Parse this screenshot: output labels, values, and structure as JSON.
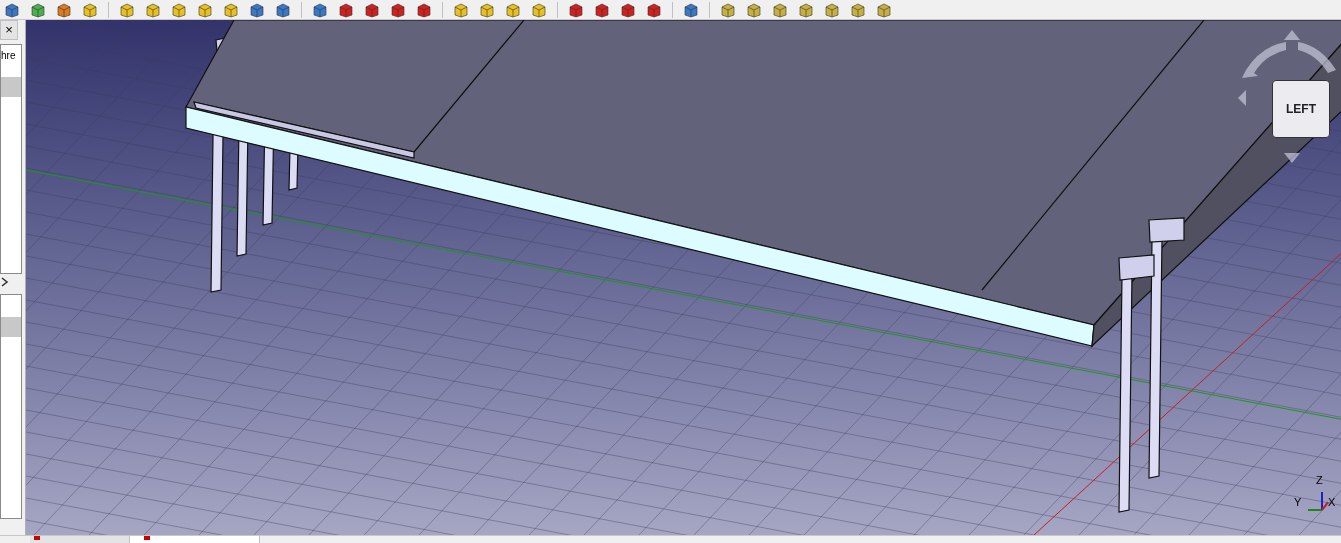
{
  "left_panel": {
    "close_label": "×",
    "tree_text": "hre",
    "tree_rows": [
      {
        "selected": true
      }
    ],
    "property_rows": [
      {
        "selected": true
      }
    ]
  },
  "navigation_cube": {
    "face_label": "LEFT"
  },
  "axis_indicator": {
    "labels": [
      "Z",
      "Y",
      "X"
    ]
  }
}
